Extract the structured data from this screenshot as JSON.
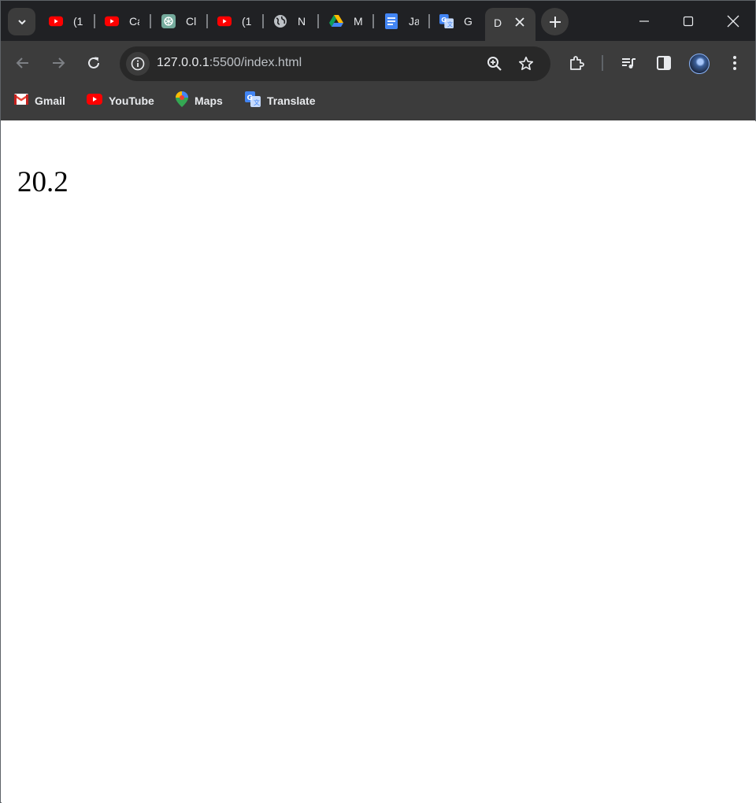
{
  "browser": {
    "tabs": [
      {
        "title": "(1",
        "icon": "youtube-icon"
      },
      {
        "title": "Ca",
        "icon": "youtube-icon"
      },
      {
        "title": "Cl",
        "icon": "chatgpt-icon"
      },
      {
        "title": "(1",
        "icon": "youtube-icon"
      },
      {
        "title": "N",
        "icon": "globe-icon"
      },
      {
        "title": "M",
        "icon": "google-drive-icon"
      },
      {
        "title": "Ja",
        "icon": "google-docs-icon"
      },
      {
        "title": "G",
        "icon": "google-translate-icon"
      }
    ],
    "active_tab": {
      "title": "D"
    },
    "url_host": "127.0.0.1",
    "url_rest": ":5500/index.html",
    "bookmarks": [
      {
        "label": "Gmail",
        "icon": "gmail-icon"
      },
      {
        "label": "YouTube",
        "icon": "youtube-icon"
      },
      {
        "label": "Maps",
        "icon": "maps-icon"
      },
      {
        "label": "Translate",
        "icon": "google-translate-icon"
      }
    ]
  },
  "page": {
    "value": "20.2"
  },
  "colors": {
    "titlebar": "#202124",
    "toolbar": "#3c3c3c",
    "omnibox": "#282828",
    "youtube_red": "#ff0000"
  }
}
